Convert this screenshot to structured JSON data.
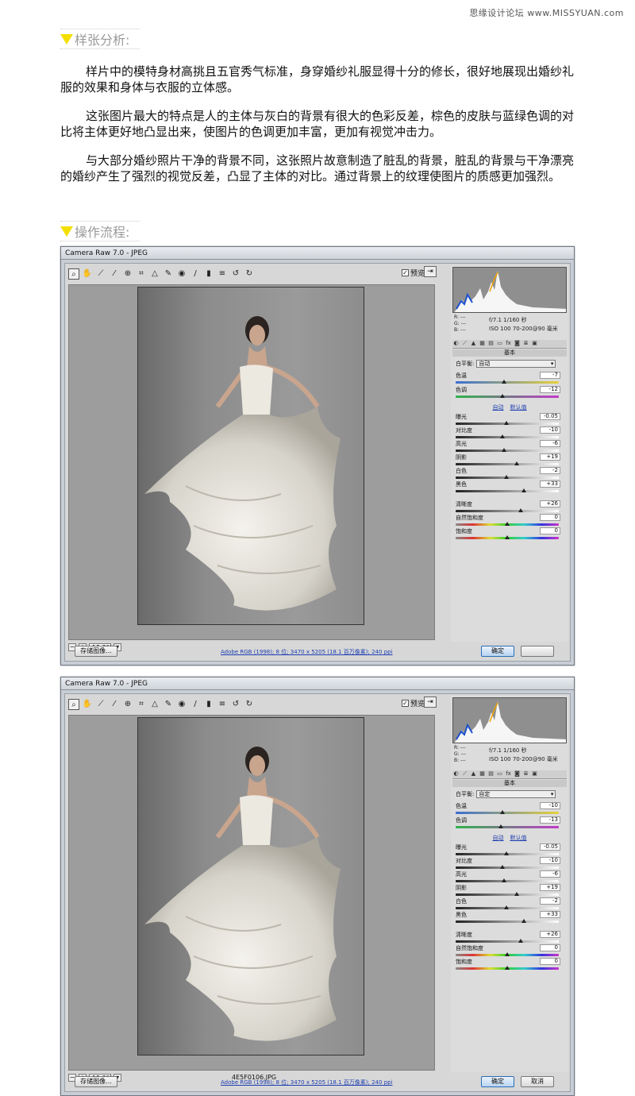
{
  "watermark": "思缘设计论坛 www.MISSYUAN.com",
  "section1": {
    "title": "样张分析:"
  },
  "paragraphs": [
    "样片中的模特身材高挑且五官秀气标准，身穿婚纱礼服显得十分的修长，很好地展现出婚纱礼服的效果和身体与衣服的立体感。",
    "这张图片最大的特点是人的主体与灰白的背景有很大的色彩反差，棕色的皮肤与蓝绿色调的对比将主体更好地凸显出来，使图片的色调更加丰富，更加有视觉冲击力。",
    "与大部分婚纱照片干净的背景不同，这张照片故意制造了脏乱的背景，脏乱的背景与干净漂亮的婚纱产生了强烈的视觉反差，凸显了主体的对比。通过背景上的纹理使图片的质感更加强烈。"
  ],
  "section2": {
    "title": "操作流程:"
  },
  "windows": [
    {
      "title": "Camera Raw 7.0 - JPEG",
      "preview_label": "预览",
      "zoom": "15.2%",
      "filename": "",
      "footer_link": "Adobe RGB (1998); 8 位; 3470 x 5205 (18.1 百万像素); 240 ppi",
      "save_button": "存储图像...",
      "ok_button": "确定",
      "cancel_button": "",
      "rgb": [
        "R: ---",
        "G: ---",
        "B: ---"
      ],
      "exif": [
        "f/7.1   1/160 秒",
        "ISO 100   70-200@90 毫米"
      ],
      "panel_title": "基本",
      "wb_label": "白平衡:",
      "wb_value": "自动",
      "auto_link": "自动",
      "default_link": "默认值",
      "temp": {
        "label": "色温",
        "value": "-7",
        "pos": 0.47
      },
      "tint": {
        "label": "色调",
        "value": "-12",
        "pos": 0.45
      },
      "tone": [
        {
          "label": "曝光",
          "value": "-0.05",
          "pos": 0.49
        },
        {
          "label": "对比度",
          "value": "-10",
          "pos": 0.45
        },
        {
          "label": "高光",
          "value": "-6",
          "pos": 0.47
        },
        {
          "label": "阴影",
          "value": "+19",
          "pos": 0.59
        },
        {
          "label": "白色",
          "value": "-2",
          "pos": 0.49
        },
        {
          "label": "黑色",
          "value": "+33",
          "pos": 0.66
        }
      ],
      "presence": [
        {
          "label": "清晰度",
          "value": "+26",
          "pos": 0.63
        },
        {
          "label": "自然饱和度",
          "value": "0",
          "pos": 0.5
        },
        {
          "label": "饱和度",
          "value": "0",
          "pos": 0.5
        }
      ]
    },
    {
      "title": "Camera Raw 7.0 - JPEG",
      "preview_label": "预览",
      "zoom": "15.2%",
      "filename": "4E5F0106.JPG",
      "footer_link": "Adobe RGB (1998); 8 位; 3470 x 5205 (18.1 百万像素); 240 ppi",
      "save_button": "存储图像...",
      "ok_button": "确定",
      "cancel_button": "取消",
      "rgb": [
        "R: ---",
        "G: ---",
        "B: ---"
      ],
      "exif": [
        "f/7.1   1/160 秒",
        "ISO 100   70-200@90 毫米"
      ],
      "panel_title": "基本",
      "wb_label": "白平衡:",
      "wb_value": "自定",
      "auto_link": "自动",
      "default_link": "默认值",
      "temp": {
        "label": "色温",
        "value": "-10",
        "pos": 0.45
      },
      "tint": {
        "label": "色调",
        "value": "-13",
        "pos": 0.44
      },
      "tone": [
        {
          "label": "曝光",
          "value": "-0.05",
          "pos": 0.49
        },
        {
          "label": "对比度",
          "value": "-10",
          "pos": 0.45
        },
        {
          "label": "高光",
          "value": "-6",
          "pos": 0.47
        },
        {
          "label": "阴影",
          "value": "+19",
          "pos": 0.59
        },
        {
          "label": "白色",
          "value": "-2",
          "pos": 0.49
        },
        {
          "label": "黑色",
          "value": "+33",
          "pos": 0.66
        }
      ],
      "presence": [
        {
          "label": "清晰度",
          "value": "+26",
          "pos": 0.63
        },
        {
          "label": "自然饱和度",
          "value": "0",
          "pos": 0.5
        },
        {
          "label": "饱和度",
          "value": "0",
          "pos": 0.5
        }
      ]
    }
  ],
  "colors": {
    "accent_yellow": "#f3e000",
    "link_blue": "#1f3fb0"
  },
  "icons": [
    "zoom-icon",
    "hand-icon",
    "white-balance-icon",
    "color-sampler-icon",
    "target-adjust-icon",
    "crop-icon",
    "straighten-icon",
    "spot-removal-icon",
    "red-eye-icon",
    "adjustment-brush-icon",
    "graduated-filter-icon",
    "preferences-icon",
    "rotate-ccw-icon",
    "rotate-cw-icon"
  ]
}
